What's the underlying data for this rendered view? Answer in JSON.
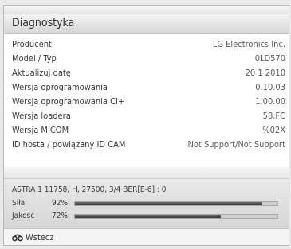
{
  "header": {
    "title": "Diagnostyka"
  },
  "info_rows": [
    {
      "label": "Producent",
      "value": "LG Electronics Inc."
    },
    {
      "label": "Model / Typ",
      "value": "0LD570"
    },
    {
      "label": "Aktualizuj datę",
      "value": "20 1 2010"
    },
    {
      "label": "Wersja oprogramowania",
      "value": "0.10.03"
    },
    {
      "label": "Wersja oprogramowania CI+",
      "value": "1.00.00"
    },
    {
      "label": "Wersja loadera",
      "value": "58.FC"
    },
    {
      "label": "Wersja MICOM",
      "value": "%02X"
    },
    {
      "label": "ID hosta / powiązany ID CAM",
      "value": "Not Support/Not Support"
    }
  ],
  "signal": {
    "channel_info": "ASTRA 1 11758, H, 27500, 3/4 BER[E-6] : 0",
    "meters": [
      {
        "label": "Siła",
        "percent_text": "92%",
        "level": 92
      },
      {
        "label": "Jakość",
        "percent_text": "72%",
        "level": 72
      }
    ]
  },
  "footer": {
    "back_label": "Wstecz",
    "back_icon": "back-icon"
  }
}
